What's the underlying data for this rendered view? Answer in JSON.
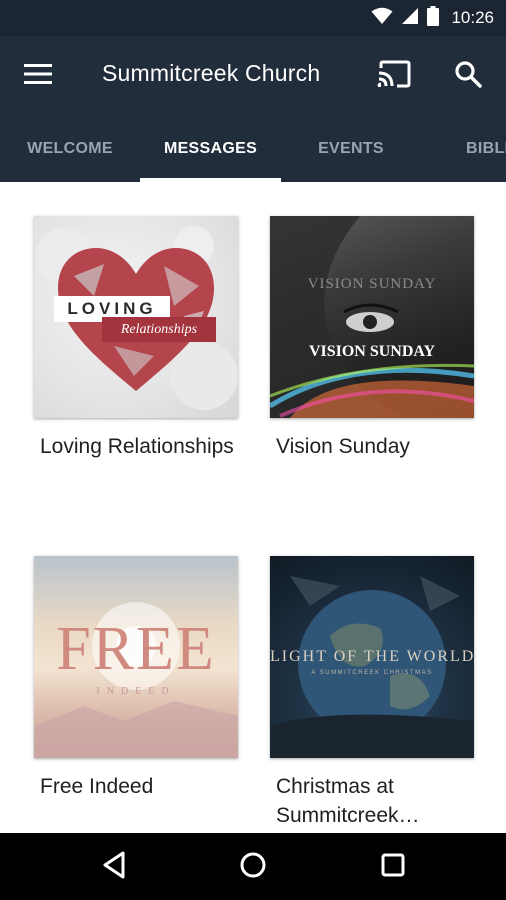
{
  "status_bar": {
    "time": "10:26",
    "icons": [
      "wifi-icon",
      "cell-signal-icon",
      "battery-icon"
    ]
  },
  "app_bar": {
    "title": "Summitcreek Church",
    "icons": [
      "menu-icon",
      "cast-icon",
      "search-icon"
    ]
  },
  "tabs": [
    {
      "label": "WELCOME",
      "active": false
    },
    {
      "label": "MESSAGES",
      "active": true
    },
    {
      "label": "EVENTS",
      "active": false
    },
    {
      "label": "BIBLE",
      "active": false
    }
  ],
  "messages": [
    {
      "title": "Loving Relationships",
      "art": {
        "line1": "LOVING",
        "line2": "Relationships"
      }
    },
    {
      "title": "Vision Sunday",
      "art": {
        "line1": "VISION SUNDAY",
        "line2": "VISION SUNDAY"
      }
    },
    {
      "title": "Free Indeed",
      "art": {
        "line1": "FREE",
        "line2": "INDEED"
      }
    },
    {
      "title": "Christmas at Summitcreek…",
      "art": {
        "line1": "LIGHT OF THE WORLD",
        "line2": "A SUMMITCREEK CHRISTMAS"
      }
    }
  ],
  "nav_bar": {
    "icons": [
      "back-icon",
      "home-icon",
      "recents-icon"
    ]
  },
  "colors": {
    "status_bar": "#1c2633",
    "app_bar": "#222d3c",
    "tab_inactive": "#9aa3af",
    "tab_active": "#ffffff",
    "card_title": "#212121",
    "nav_bar": "#000000"
  }
}
